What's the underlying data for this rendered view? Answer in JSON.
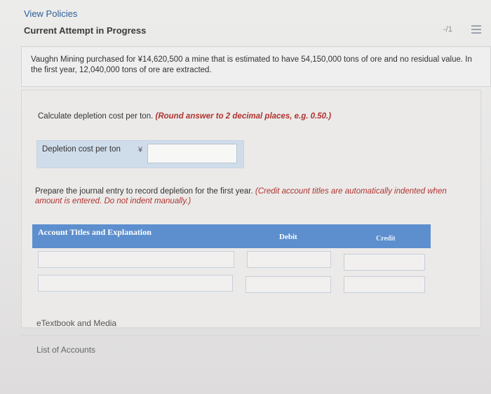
{
  "header": {
    "view_policies": "View Policies",
    "current_attempt": "Current Attempt in Progress",
    "score": "-/1"
  },
  "question": {
    "text": "Vaughn Mining purchased for ¥14,620,500 a mine that is estimated to have 54,150,000 tons of ore and no residual value. In the first year, 12,040,000 tons of ore are extracted."
  },
  "part1": {
    "prompt": "Calculate depletion cost per ton.",
    "hint": "(Round answer to 2 decimal places, e.g. 0.50.)",
    "field_label": "Depletion cost per ton",
    "currency": "¥",
    "value": ""
  },
  "part2": {
    "prompt": "Prepare the journal entry to record depletion for the first year.",
    "hint": "(Credit account titles are automatically indented when amount is entered. Do not indent manually.)",
    "columns": {
      "account": "Account Titles and Explanation",
      "debit": "Debit",
      "credit": "Credit"
    },
    "rows": [
      {
        "account": "",
        "debit": "",
        "credit": ""
      },
      {
        "account": "",
        "debit": "",
        "credit": ""
      }
    ]
  },
  "footer": {
    "etextbook": "eTextbook and Media",
    "list_accounts": "List of Accounts"
  }
}
